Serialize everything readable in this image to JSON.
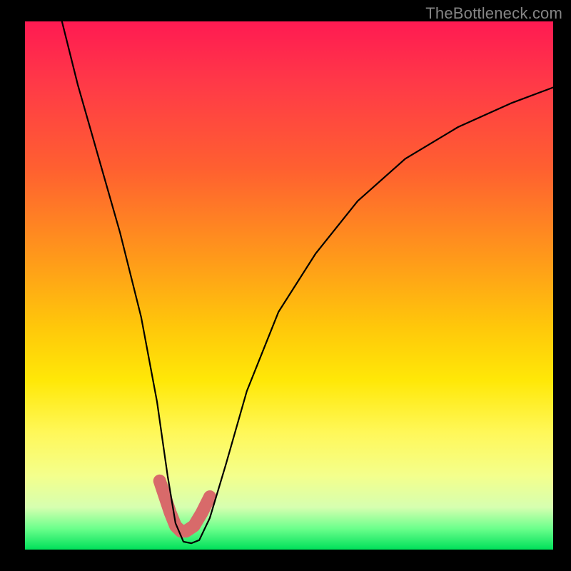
{
  "watermark": "TheBottleneck.com",
  "chart_data": {
    "type": "line",
    "title": "",
    "xlabel": "",
    "ylabel": "",
    "xlim": [
      0,
      100
    ],
    "ylim": [
      0,
      100
    ],
    "series": [
      {
        "name": "curve",
        "x": [
          7,
          10,
          14,
          18,
          22,
          25,
          27,
          28.5,
          30,
          31.5,
          33,
          35,
          38,
          42,
          48,
          55,
          63,
          72,
          82,
          92,
          100
        ],
        "values": [
          100,
          88,
          74,
          60,
          44,
          28,
          14,
          5,
          1.5,
          1.2,
          1.8,
          6,
          16,
          30,
          45,
          56,
          66,
          74,
          80,
          84.5,
          87.5
        ]
      },
      {
        "name": "marker-band",
        "x": [
          25.5,
          26.5,
          27.5,
          28.5,
          29.5,
          30.5,
          32,
          33.5,
          35
        ],
        "values": [
          13,
          10,
          7,
          4.5,
          3.5,
          3.5,
          4.5,
          7,
          10
        ]
      }
    ],
    "colors": {
      "curve": "#000000",
      "marker": "#d86a6a"
    }
  }
}
